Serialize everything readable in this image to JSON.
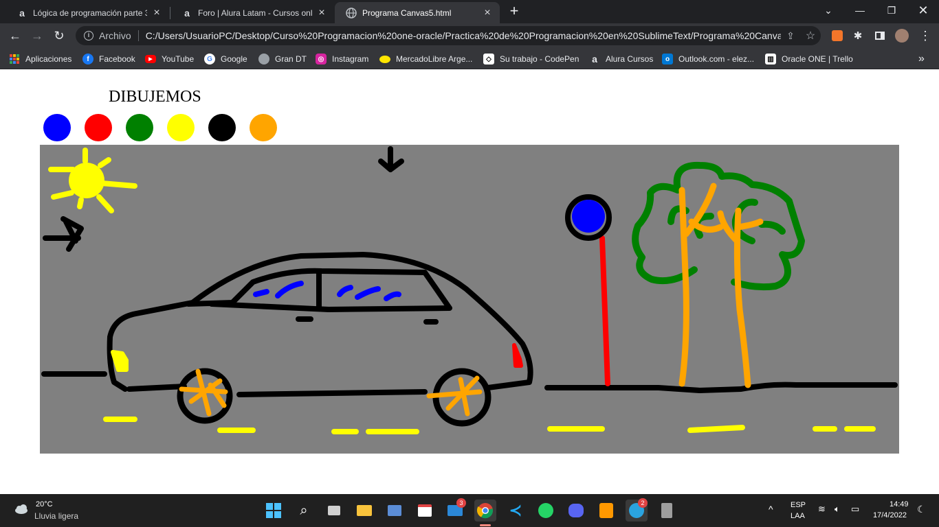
{
  "browser": {
    "tabs": [
      {
        "title": "Lógica de programación parte 3:",
        "favicon": "alura-icon",
        "active": false
      },
      {
        "title": "Foro | Alura Latam - Cursos onlin",
        "favicon": "alura-icon",
        "active": false
      },
      {
        "title": "Programa Canvas5.html",
        "favicon": "globe-icon",
        "active": true
      }
    ],
    "new_tab": "+",
    "address": {
      "scheme_label": "Archivo",
      "url": "C:/Users/UsuarioPC/Desktop/Curso%20Programacion%20one-oracle/Practica%20de%20Programacion%20en%20SublimeText/Programa%20Canva..."
    },
    "bookmarks": [
      {
        "label": "Aplicaciones",
        "icon": "apps-grid-icon",
        "color": "#ea4335"
      },
      {
        "label": "Facebook",
        "icon": "facebook-icon",
        "color": "#1877f2"
      },
      {
        "label": "YouTube",
        "icon": "youtube-icon",
        "color": "#ff0000"
      },
      {
        "label": "Google",
        "icon": "google-icon",
        "color": "#ffffff"
      },
      {
        "label": "Gran DT",
        "icon": "soccer-ball-icon",
        "color": "#9aa0a6"
      },
      {
        "label": "Instagram",
        "icon": "instagram-icon",
        "color": "#d6249f"
      },
      {
        "label": "MercadoLibre Arge...",
        "icon": "mercadolibre-icon",
        "color": "#ffe600"
      },
      {
        "label": "Su trabajo - CodePen",
        "icon": "codepen-icon",
        "color": "#ffffff"
      },
      {
        "label": "Alura Cursos",
        "icon": "alura-icon",
        "color": "#e8eaed"
      },
      {
        "label": "Outlook.com - elez...",
        "icon": "outlook-icon",
        "color": "#0078d4"
      },
      {
        "label": "Oracle ONE | Trello",
        "icon": "trello-icon",
        "color": "#ffffff"
      }
    ],
    "bookmarks_overflow": "»"
  },
  "page": {
    "title": "DIBUJEMOS",
    "palette": [
      {
        "name": "blue",
        "color": "#0000ff"
      },
      {
        "name": "red",
        "color": "#ff0000"
      },
      {
        "name": "green",
        "color": "#008000"
      },
      {
        "name": "yellow",
        "color": "#ffff00"
      },
      {
        "name": "black",
        "color": "#000000"
      },
      {
        "name": "orange",
        "color": "#ffa500"
      }
    ],
    "canvas": {
      "background": "#808080"
    }
  },
  "taskbar": {
    "weather": {
      "temp": "20°C",
      "desc": "Lluvia ligera"
    },
    "lang": {
      "line1": "ESP",
      "line2": "LAA"
    },
    "clock": {
      "time": "14:49",
      "date": "17/4/2022"
    },
    "badges": {
      "mail": "3",
      "telegram": "2"
    }
  }
}
